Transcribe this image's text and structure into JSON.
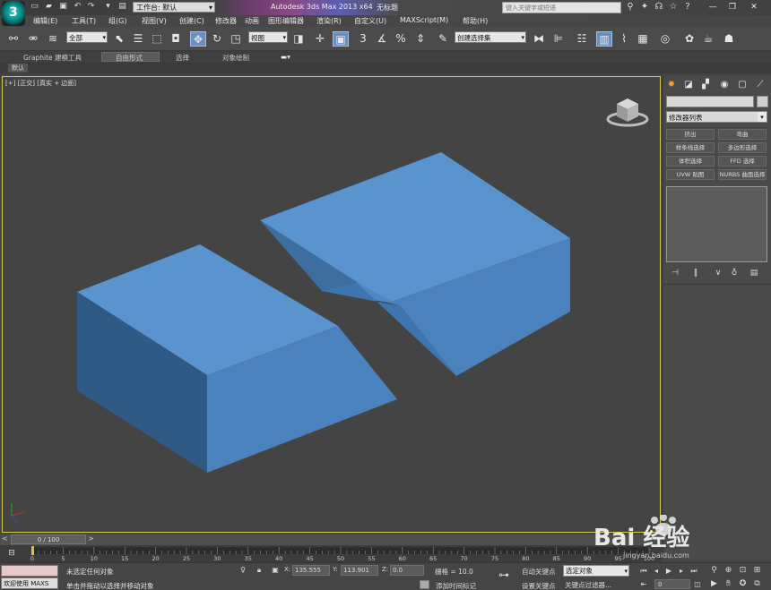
{
  "titlebar": {
    "workspace_value": "工作台: 默认",
    "app_title": "Autodesk 3ds Max  2013 x64",
    "document": "无标题",
    "search_placeholder": "键入关键字或短语"
  },
  "menus": [
    {
      "label": "编辑(E)"
    },
    {
      "label": "工具(T)"
    },
    {
      "label": "组(G)"
    },
    {
      "label": "视图(V)"
    },
    {
      "label": "创建(C)"
    },
    {
      "label": "修改器"
    },
    {
      "label": "动画"
    },
    {
      "label": "图形编辑器"
    },
    {
      "label": "渲染(R)"
    },
    {
      "label": "自定义(U)"
    },
    {
      "label": "MAXScript(M)"
    },
    {
      "label": "帮助(H)"
    }
  ],
  "toolbar": {
    "selection_filter": "全部",
    "ref_coord": "视图",
    "named_selection": "创建选择集"
  },
  "ribbon": {
    "tabs": [
      {
        "label": "Graphite 建模工具"
      },
      {
        "label": "自由形式"
      },
      {
        "label": "选择"
      },
      {
        "label": "对象绘制"
      }
    ],
    "sub_label": "默认"
  },
  "viewport": {
    "label": "[+] [正交] [真实 + 边面]",
    "object_color": "#5b8fc7",
    "background": "#444444",
    "active_border": "#d8c84a"
  },
  "command_panel": {
    "modifier_list": "修改器列表",
    "buttons": [
      {
        "label": "挤出"
      },
      {
        "label": "弯曲"
      },
      {
        "label": "样条线选择"
      },
      {
        "label": "多边形选择"
      },
      {
        "label": "体积选择"
      },
      {
        "label": "FFD 选择"
      },
      {
        "label": "UVW 贴图"
      },
      {
        "label": "NURBS 曲面选择"
      }
    ]
  },
  "timeline": {
    "frame_display": "0 / 100",
    "ticks": [
      "0",
      "5",
      "10",
      "15",
      "20",
      "25",
      "30",
      "35",
      "40",
      "45",
      "50",
      "55",
      "60",
      "65",
      "70",
      "75",
      "80",
      "85",
      "90",
      "95",
      "100"
    ]
  },
  "statusbar": {
    "welcome": "欢迎使用 MAXS",
    "status_line1": "未选定任何对象",
    "status_line2": "单击并拖动以选择并移动对象",
    "x_label": "X:",
    "x_value": "135.555",
    "y_label": "Y:",
    "y_value": "113.901",
    "z_label": "Z:",
    "z_value": "0.0",
    "grid": "栅格 = 10.0",
    "add_time_tag": "添加时间标记",
    "auto_key": "自动关键点",
    "set_key": "设置关键点",
    "selection_set": "选定对象",
    "key_filters": "关键点过滤器...",
    "current_frame": "0"
  },
  "watermark": {
    "brand": "Bai 经验",
    "url": "jingyan.baidu.com"
  }
}
